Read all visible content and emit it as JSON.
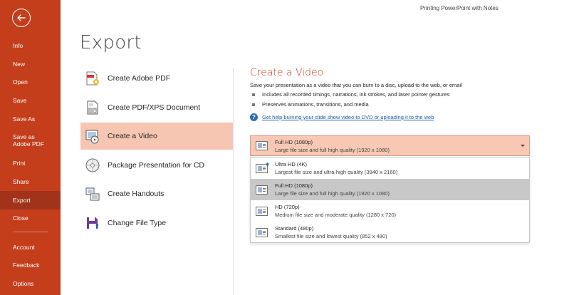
{
  "doc_title": "Printing PowerPoint with Notes",
  "page_title": "Export",
  "sidebar": {
    "items": [
      {
        "label": "Info"
      },
      {
        "label": "New"
      },
      {
        "label": "Open"
      },
      {
        "label": "Save"
      },
      {
        "label": "Save As"
      },
      {
        "label": "Save as Adobe PDF"
      },
      {
        "label": "Print"
      },
      {
        "label": "Share"
      },
      {
        "label": "Export"
      },
      {
        "label": "Close"
      },
      {
        "label": "Account"
      },
      {
        "label": "Feedback"
      },
      {
        "label": "Options"
      }
    ],
    "active": "Export"
  },
  "options": [
    {
      "label": "Create Adobe PDF",
      "icon": "adobe-pdf-icon"
    },
    {
      "label": "Create PDF/XPS Document",
      "icon": "pdf-xps-icon"
    },
    {
      "label": "Create a Video",
      "icon": "video-icon"
    },
    {
      "label": "Package Presentation for CD",
      "icon": "cd-icon"
    },
    {
      "label": "Create Handouts",
      "icon": "handouts-icon"
    },
    {
      "label": "Change File Type",
      "icon": "file-type-icon"
    }
  ],
  "detail": {
    "title": "Create a Video",
    "description": "Save your presentation as a video that you can burn to a disc, upload to the web, or email",
    "bullets": [
      "Includes all recorded timings, narrations, ink strokes, and laser pointer gestures",
      "Preserves animations, transitions, and media"
    ],
    "help_link": "Get help burning your slide show video to DVD or uploading it to the web"
  },
  "quality": {
    "selected": {
      "title": "Full HD (1080p)",
      "subtitle": "Large file size and full high quality (1920 x 1080)"
    },
    "options": [
      {
        "title": "Ultra HD (4K)",
        "subtitle": "Largest file size and ultra-high quality (3840 x 2160)"
      },
      {
        "title": "Full HD (1080p)",
        "subtitle": "Large file size and full high quality (1920 x 1080)"
      },
      {
        "title": "HD (720p)",
        "subtitle": "Medium file size and moderate quality (1280 x 720)"
      },
      {
        "title": "Standard (480p)",
        "subtitle": "Smallest file size and lowest quality (852 x 480)"
      }
    ]
  },
  "colors": {
    "sidebar": "#c43e1c",
    "sidebar_active": "#a0331a",
    "accent_title": "#c43e1c",
    "selected_option": "#f6c6b3"
  }
}
